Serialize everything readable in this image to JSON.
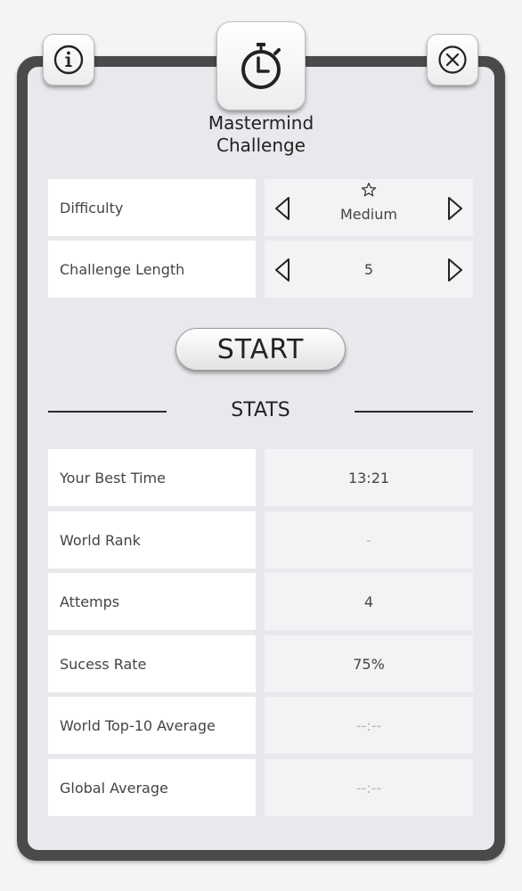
{
  "header": {
    "title_line1": "Mastermind",
    "title_line2": "Challenge",
    "info_icon": "info-circle-icon",
    "close_icon": "close-circle-icon",
    "timer_icon": "stopwatch-icon"
  },
  "settings": {
    "difficulty": {
      "label": "Difficulty",
      "value": "Medium",
      "icon": "star-outline-icon"
    },
    "challenge_length": {
      "label": "Challenge Length",
      "value": "5"
    }
  },
  "start_label": "START",
  "stats": {
    "title": "STATS",
    "rows": [
      {
        "label": "Your Best Time",
        "value": "13:21"
      },
      {
        "label": "World Rank",
        "value": "-"
      },
      {
        "label": "Attemps",
        "value": "4"
      },
      {
        "label": "Sucess Rate",
        "value": "75%"
      },
      {
        "label": "World Top-10 Average",
        "value": "--:--"
      },
      {
        "label": "Global Average",
        "value": "--:--"
      }
    ]
  },
  "colors": {
    "frame": "#4a4a4a",
    "panel": "#e9e9ed",
    "label_cell": "#ffffff",
    "value_cell": "#f3f3f5",
    "muted_text": "#b8b8b8"
  }
}
